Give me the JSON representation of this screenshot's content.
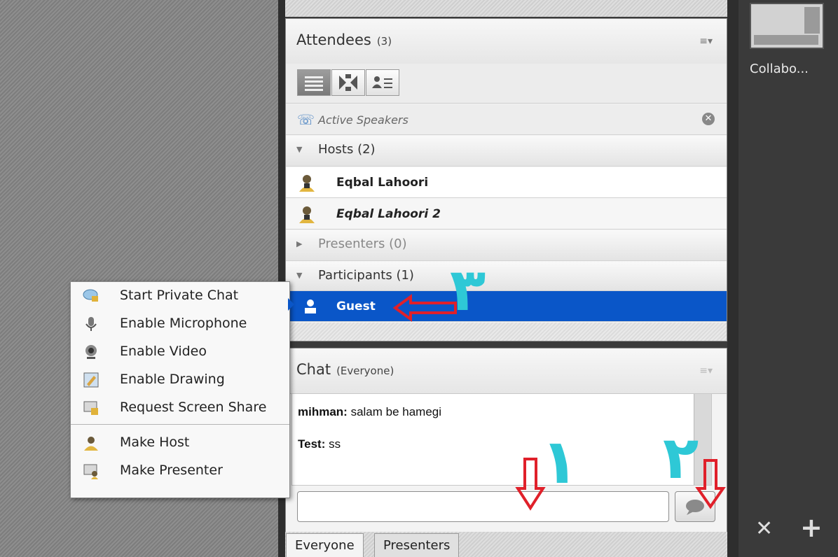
{
  "attendees": {
    "title": "Attendees",
    "count": "(3)",
    "active_speakers": "Active Speakers",
    "sections": {
      "hosts": "Hosts (2)",
      "presenters": "Presenters (0)",
      "participants": "Participants (1)"
    },
    "hosts": [
      "Eqbal Lahoori",
      "Eqbal Lahoori 2"
    ],
    "participants": [
      "Guest"
    ]
  },
  "chat": {
    "title": "Chat",
    "scope": "(Everyone)",
    "messages": [
      {
        "sender": "mihman:",
        "text": " salam be hamegi"
      },
      {
        "sender": "Test:",
        "text": " ss"
      }
    ],
    "input_placeholder": "",
    "tabs": [
      "Everyone",
      "Presenters"
    ]
  },
  "context_menu": {
    "group1": [
      "Start Private Chat",
      "Enable Microphone",
      "Enable Video",
      "Enable Drawing",
      "Request Screen Share"
    ],
    "group2": [
      "Make Host",
      "Make Presenter"
    ]
  },
  "layout_rail": {
    "label": "Collabo..."
  },
  "annotations": {
    "marker_1": "١",
    "marker_2": "٢",
    "marker_3": "٣"
  },
  "colors": {
    "selection": "#0a56c8",
    "annotation_cyan": "#2ec8d6",
    "annotation_red": "#e0202a"
  }
}
